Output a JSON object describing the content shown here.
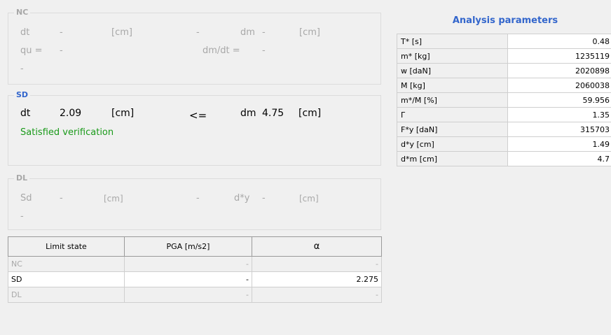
{
  "nc": {
    "title": "NC",
    "dt_label": "dt",
    "dt_value": "-",
    "dt_unit": "[cm]",
    "cmp": "-",
    "dm_label": "dm",
    "dm_value": "-",
    "dm_unit": "[cm]",
    "qu_label": "qu =",
    "qu_value": "-",
    "dmdt_label": "dm/dt =",
    "dmdt_value": "-",
    "status": "-"
  },
  "sd": {
    "title": "SD",
    "dt_label": "dt",
    "dt_value": "2.09",
    "dt_unit": "[cm]",
    "cmp": "<=",
    "dm_label": "dm",
    "dm_value": "4.75",
    "dm_unit": "[cm]",
    "status": "Satisfied verification"
  },
  "dl": {
    "title": "DL",
    "sd_label": "Sd",
    "sd_value": "-",
    "sd_unit": "[cm]",
    "cmp": "-",
    "dy_label": "d*y",
    "dy_value": "-",
    "dy_unit": "[cm]",
    "status": "-"
  },
  "limit_table": {
    "headers": [
      "Limit state",
      "PGA [m/s2]",
      "α"
    ],
    "rows": [
      {
        "state": "NC",
        "pga": "-",
        "alpha": "-"
      },
      {
        "state": "SD",
        "pga": "-",
        "alpha": "2.275"
      },
      {
        "state": "DL",
        "pga": "-",
        "alpha": "-"
      }
    ]
  },
  "analysis": {
    "title": "Analysis parameters",
    "rows": [
      {
        "label": "T* [s]",
        "value": "0.48"
      },
      {
        "label": "m* [kg]",
        "value": "1235119"
      },
      {
        "label": "w [daN]",
        "value": "2020898"
      },
      {
        "label": "M [kg]",
        "value": "2060038"
      },
      {
        "label": "m*/M [%]",
        "value": "59.956"
      },
      {
        "label": "Γ",
        "value": "1.35"
      },
      {
        "label": "F*y [daN]",
        "value": "315703"
      },
      {
        "label": "d*y [cm]",
        "value": "1.49"
      },
      {
        "label": "d*m [cm]",
        "value": "4.7"
      }
    ]
  }
}
